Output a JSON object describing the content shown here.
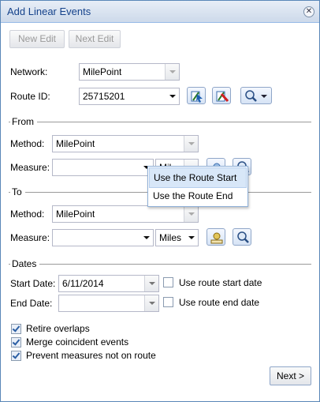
{
  "window": {
    "title": "Add Linear Events"
  },
  "toolbar": {
    "new_edit": "New Edit",
    "next_edit": "Next Edit"
  },
  "network": {
    "label": "Network:",
    "value": "MilePoint"
  },
  "route": {
    "label": "Route ID:",
    "value": "25715201"
  },
  "from": {
    "section": "From",
    "method_label": "Method:",
    "method_value": "MilePoint",
    "measure_label": "Measure:",
    "measure_value": "",
    "units_value": "Mil"
  },
  "dropdown_menu": {
    "items": [
      "Use the Route Start",
      "Use the Route End"
    ],
    "highlighted": 0
  },
  "to": {
    "section": "To",
    "method_label": "Method:",
    "method_value": "MilePoint",
    "measure_label": "Measure:",
    "measure_value": "",
    "units_value": "Miles"
  },
  "dates": {
    "section": "Dates",
    "start_label": "Start Date:",
    "start_value": "6/11/2014",
    "start_check": "Use route start date",
    "end_label": "End Date:",
    "end_value": "",
    "end_check": "Use route end date"
  },
  "options": [
    {
      "label": "Retire overlaps",
      "checked": true
    },
    {
      "label": "Merge coincident events",
      "checked": true
    },
    {
      "label": "Prevent measures not on route",
      "checked": true
    }
  ],
  "footer": {
    "next": "Next >"
  }
}
